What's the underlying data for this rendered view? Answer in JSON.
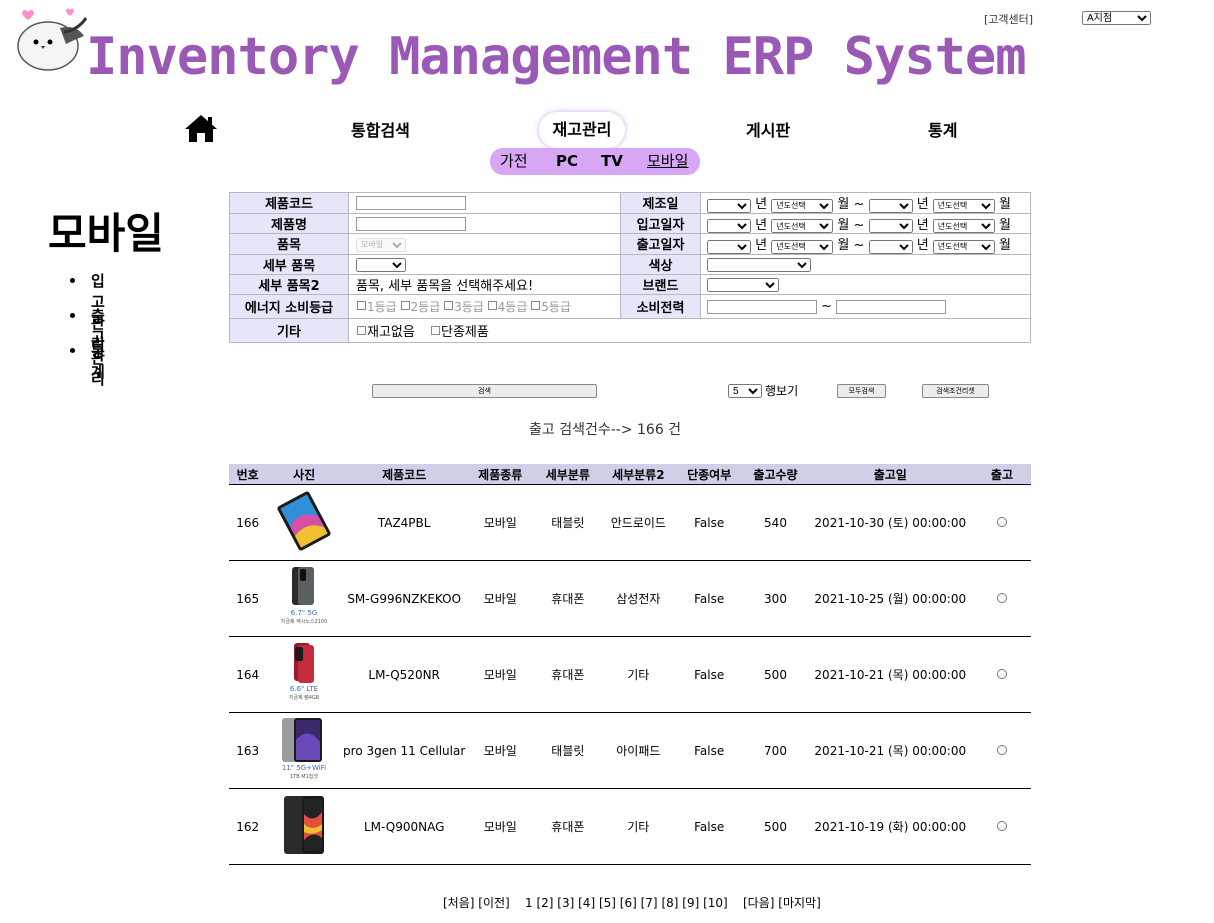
{
  "header": {
    "title": "Inventory Management ERP System",
    "customer_center": "[고객센터]",
    "branch_selected": "A지점"
  },
  "nav": {
    "search": "통합검색",
    "inventory": "재고관리",
    "board": "게시판",
    "stats": "통계",
    "sub": [
      "가전",
      "PC",
      "TV",
      "모바일"
    ]
  },
  "side": {
    "title": "모바일",
    "items": [
      "입고 관리",
      "출고 관리",
      "통계"
    ]
  },
  "form": {
    "product_code": "제품코드",
    "product_name": "제품명",
    "category": "품목",
    "category_value": "모바일",
    "subcategory": "세부 품목",
    "subcategory2": "세부 품목2",
    "subcategory2_hint": "품목, 세부 품목을 선택해주세요!",
    "energy": "에너지 소비등급",
    "grades": [
      "1등급",
      "2등급",
      "3등급",
      "4등급",
      "5등급"
    ],
    "etc": "기타",
    "etc_options": [
      "재고없음",
      "단종제품"
    ],
    "mfg_date": "제조일",
    "in_date": "입고일자",
    "out_date": "출고일자",
    "color": "색상",
    "brand": "브랜드",
    "power": "소비전력",
    "year": "년",
    "month": "월",
    "month_select": "년도선택",
    "tilde": "~"
  },
  "controls": {
    "search_button": "검색",
    "rows_value": "5",
    "rows_label": "행보기",
    "all_search": "모두검색",
    "reset": "검색조건리셋"
  },
  "count_line": "출고 검색건수--> 166 건",
  "table": {
    "headers": [
      "번호",
      "사진",
      "제품코드",
      "제품종류",
      "세부분류",
      "세부분류2",
      "단종여부",
      "출고수량",
      "출고일",
      "출고"
    ],
    "rows": [
      {
        "no": "166",
        "code": "TAZ4PBL",
        "type": "모바일",
        "sub": "태블릿",
        "sub2": "안드로이드",
        "disc": "False",
        "qty": "540",
        "date": "2021-10-30 (토) 00:00:00",
        "caption1": "",
        "caption2": ""
      },
      {
        "no": "165",
        "code": "SM-G996NZKEKOO",
        "type": "모바일",
        "sub": "휴대폰",
        "sub2": "삼성전자",
        "disc": "False",
        "qty": "300",
        "date": "2021-10-25 (월) 00:00:00",
        "caption1": "6.7\" 5G",
        "caption2": "지금제 엑시노스2100"
      },
      {
        "no": "164",
        "code": "LM-Q520NR",
        "type": "모바일",
        "sub": "휴대폰",
        "sub2": "기타",
        "disc": "False",
        "qty": "500",
        "date": "2021-10-21 (목) 00:00:00",
        "caption1": "6.6\" LTE",
        "caption2": "지금제 램4GB"
      },
      {
        "no": "163",
        "code": "pro 3gen 11 Cellular",
        "type": "모바일",
        "sub": "태블릿",
        "sub2": "아이패드",
        "disc": "False",
        "qty": "700",
        "date": "2021-10-21 (목) 00:00:00",
        "caption1": "11\" 5G+WiFi",
        "caption2": "1TB M1칩셋"
      },
      {
        "no": "162",
        "code": "LM-Q900NAG",
        "type": "모바일",
        "sub": "휴대폰",
        "sub2": "기타",
        "disc": "False",
        "qty": "500",
        "date": "2021-10-19 (화) 00:00:00",
        "caption1": "",
        "caption2": ""
      }
    ]
  },
  "pager": {
    "first": "[처음]",
    "prev": "[이전]",
    "pages": [
      "1",
      "[2]",
      "[3]",
      "[4]",
      "[5]",
      "[6]",
      "[7]",
      "[8]",
      "[9]",
      "[10]"
    ],
    "next": "[다음]",
    "last": "[마지막]"
  },
  "colors": {
    "title": "#9b59b6",
    "subnav": "#d7a6f4",
    "label_bg": "#e6e6fa",
    "header_bg": "#cfcfe8"
  }
}
